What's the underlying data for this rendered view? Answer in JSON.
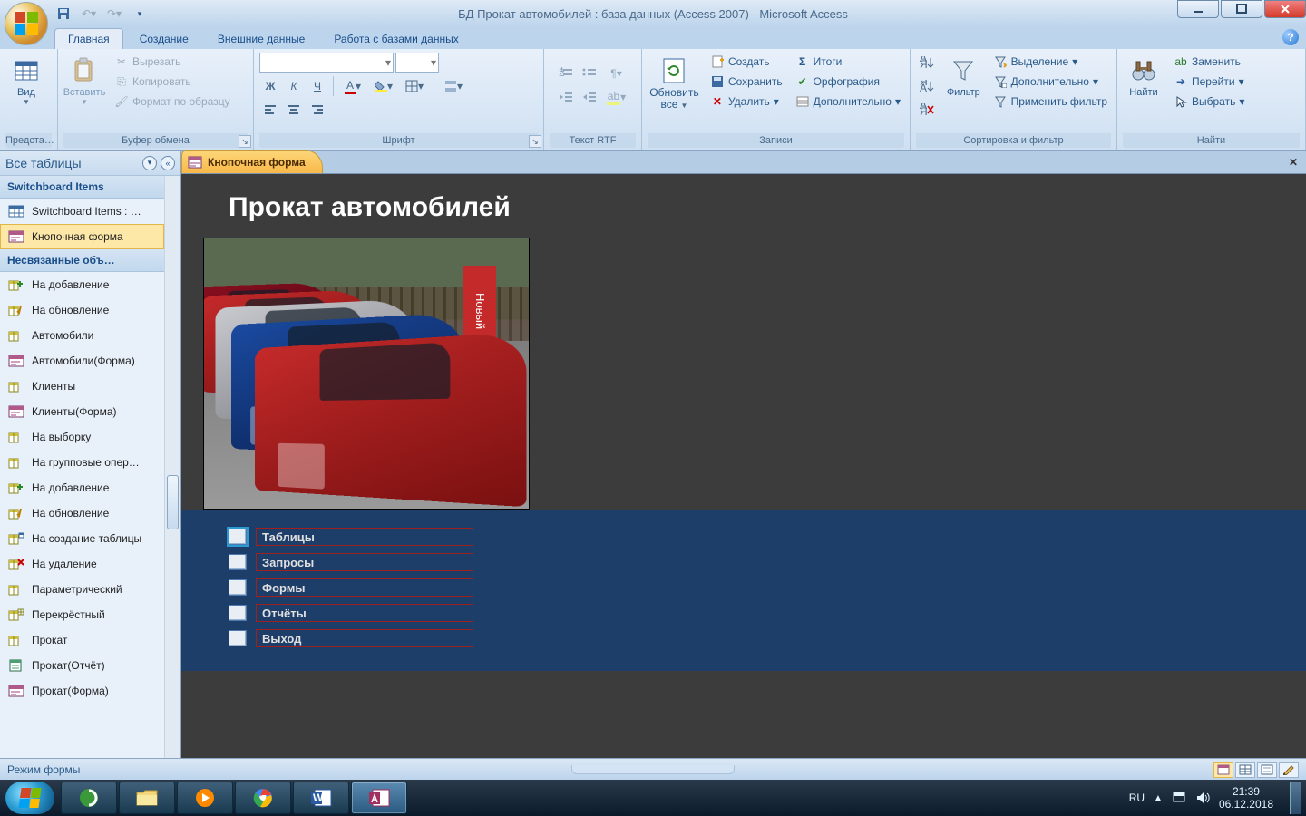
{
  "title": "БД Прокат автомобилей : база данных (Access 2007) - Microsoft Access",
  "tabs": {
    "home": "Главная",
    "create": "Создание",
    "external": "Внешние данные",
    "dbtools": "Работа с базами данных"
  },
  "groups": {
    "views": "Предста…",
    "views_btn": "Вид",
    "clipboard": "Буфер обмена",
    "paste": "Вставить",
    "cut": "Вырезать",
    "copy": "Копировать",
    "painter": "Формат по образцу",
    "font": "Шрифт",
    "richtext": "Текст RTF",
    "records": "Записи",
    "refresh": "Обновить",
    "refresh2": "все",
    "new": "Создать",
    "save": "Сохранить",
    "delete": "Удалить",
    "totals": "Итоги",
    "spelling": "Орфография",
    "more": "Дополнительно",
    "sortfilter": "Сортировка и фильтр",
    "filter": "Фильтр",
    "selection": "Выделение",
    "advanced": "Дополнительно",
    "toggle": "Применить фильтр",
    "find": "Найти",
    "findbtn": "Найти",
    "replace": "Заменить",
    "goto": "Перейти",
    "select": "Выбрать"
  },
  "nav": {
    "title": "Все таблицы",
    "g1": "Switchboard Items",
    "g1_items": [
      "Switchboard Items : …",
      "Кнопочная форма"
    ],
    "g2": "Несвязанные объ…",
    "g2_items": [
      "На добавление",
      "На обновление",
      "Автомобили",
      "Автомобили(Форма)",
      "Клиенты",
      "Клиенты(Форма)",
      "На выборку",
      "На групповые опер…",
      "На добавление",
      "На обновление",
      "На создание таблицы",
      "На удаление",
      "Параметрический",
      "Перекрёстный",
      "Прокат",
      "Прокат(Отчёт)",
      "Прокат(Форма)"
    ]
  },
  "doc": {
    "tab": "Кнопочная форма"
  },
  "form": {
    "title": "Прокат автомобилей",
    "banner": "Новый",
    "menu": [
      "Таблицы",
      "Запросы",
      "Формы",
      "Отчёты",
      "Выход"
    ]
  },
  "status": "Режим формы",
  "tray": {
    "lang": "RU",
    "time": "21:39",
    "date": "06.12.2018"
  }
}
